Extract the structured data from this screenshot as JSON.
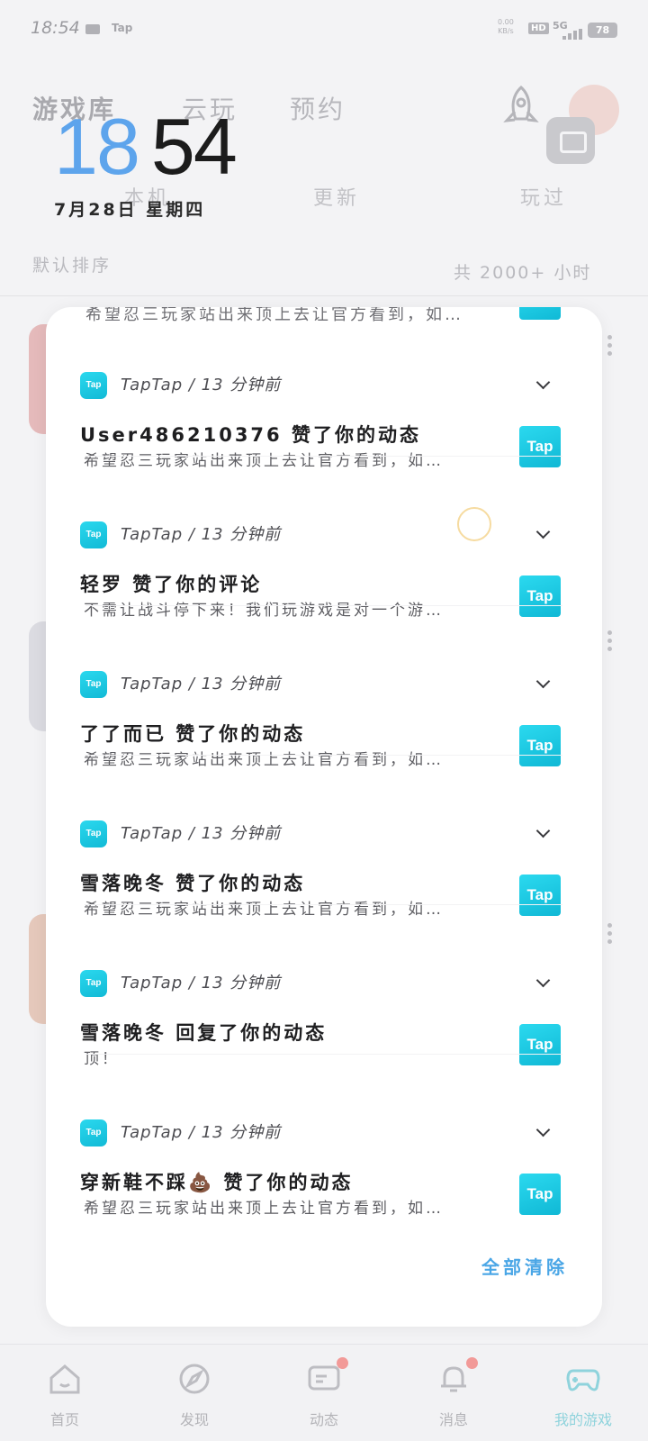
{
  "status_bar": {
    "time": "18:54",
    "tap_label": "Tap",
    "net_speed_value": "0.00",
    "net_speed_unit": "KB/s",
    "hd_label": "HD",
    "signal_label": "5G",
    "battery": "78"
  },
  "background": {
    "tabs": [
      "游戏库",
      "云玩",
      "预约"
    ],
    "filters": [
      "本机",
      "更新",
      "玩过"
    ],
    "sort_label": "默认排序",
    "hours_label": "共 2000+ 小时",
    "nav": [
      {
        "icon": "home-icon",
        "label": "首页"
      },
      {
        "icon": "discover-icon",
        "label": "发现"
      },
      {
        "icon": "moments-icon",
        "label": "动态"
      },
      {
        "icon": "bell-icon",
        "label": "消息"
      },
      {
        "icon": "gamepad-icon",
        "label": "我的游戏"
      }
    ]
  },
  "clock": {
    "hours": "18",
    "minutes": "54",
    "date": "7月28日 星期四"
  },
  "panel": {
    "peek_body": "希望忍三玩家站出来顶上去让官方看到，如…",
    "notifications": [
      {
        "app": "TapTap",
        "time": "13 分钟前",
        "title": "User486210376 赞了你的动态",
        "body": "希望忍三玩家站出来顶上去让官方看到，如…",
        "thumb": "Tap"
      },
      {
        "app": "TapTap",
        "time": "13 分钟前",
        "title": "轻罗 赞了你的评论",
        "body": "不需让战斗停下来！我们玩游戏是对一个游…",
        "thumb": "Tap"
      },
      {
        "app": "TapTap",
        "time": "13 分钟前",
        "title": "了了而已 赞了你的动态",
        "body": "希望忍三玩家站出来顶上去让官方看到，如…",
        "thumb": "Tap"
      },
      {
        "app": "TapTap",
        "time": "13 分钟前",
        "title": "雪落晚冬 赞了你的动态",
        "body": "希望忍三玩家站出来顶上去让官方看到，如…",
        "thumb": "Tap"
      },
      {
        "app": "TapTap",
        "time": "13 分钟前",
        "title": "雪落晚冬 回复了你的动态",
        "body": "顶！",
        "thumb": "Tap"
      },
      {
        "app": "TapTap",
        "time": "13 分钟前",
        "title": "穿新鞋不踩💩 赞了你的动态",
        "body": "希望忍三玩家站出来顶上去让官方看到，如…",
        "thumb": "Tap"
      }
    ],
    "app_icon_text": "Tap",
    "meta_separator": " / ",
    "clear_all": "全部清除"
  },
  "colors": {
    "accent_blue": "#5da4ec",
    "tap_cyan": "#12bad6",
    "clear_all": "#4aa6e6"
  }
}
